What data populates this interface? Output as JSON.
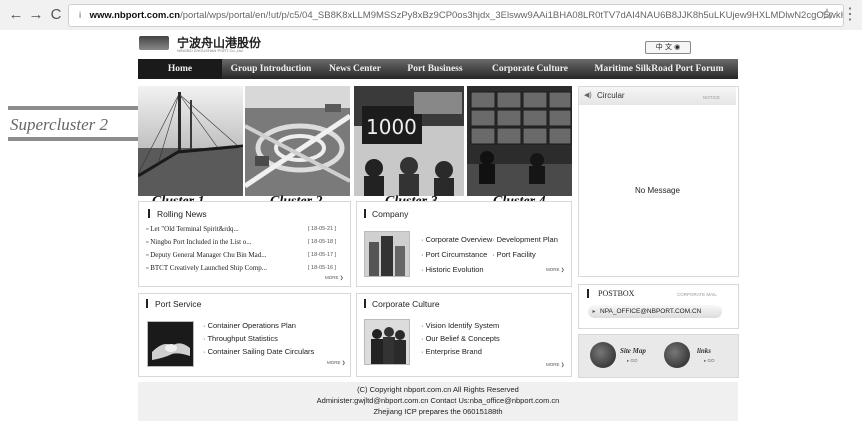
{
  "browser": {
    "back": "←",
    "forward": "→",
    "reload": "C",
    "info_icon": "i",
    "url_host": "www.nbport.com.cn",
    "url_path": "/portal/wps/portal/en/!ut/p/c5/04_SB8K8xLLM9MSSzPy8xBz9CP0os3hjdx_3Elsww9AAi1BHA08LR0tTV7dAI4NAU6B8JJK8h5uLKUjew9HXLMDlwN2cgO5wkH349YPkDXAAR...",
    "star_icon": "☆",
    "menu_icon": "⋮"
  },
  "header": {
    "logo_cn": "宁波舟山港股份",
    "logo_en": "NINGBO ZHOUSHAN PORT Co.,Ltd.",
    "language_select": "中 文 ◉"
  },
  "nav": {
    "items": [
      "Home",
      "Group Introduction",
      "News Center",
      "Port Business",
      "Corporate Culture",
      "Maritime SilkRoad Port Forum"
    ]
  },
  "annotations": {
    "supercluster": "Supercluster 2",
    "clusters": [
      "Cluster 1",
      "Cluster 2",
      "Cluster 3",
      "Cluster 4"
    ]
  },
  "rolling_news": {
    "title": "Rolling News",
    "items": [
      {
        "text": "Let \"Old Terminal Spirit&rdq...",
        "date": "[ 18-05-21 ]"
      },
      {
        "text": "Ningbo Port Included in the List o...",
        "date": "[ 18-05-18 ]"
      },
      {
        "text": "Deputy General Manager Chu Bin Mad...",
        "date": "[ 18-05-17 ]"
      },
      {
        "text": "BTCT Creatively Launched Ship Comp...",
        "date": "[ 18-05-16 ]"
      }
    ],
    "more": "MORE ❯"
  },
  "company": {
    "title": "Company",
    "links": [
      "Corporate Overview",
      "Development Plan",
      "Port Circumstance",
      "Port Facility",
      "Historic Evolution"
    ],
    "more": "MORE ❯"
  },
  "port_service": {
    "title": "Port Service",
    "links": [
      "Container Operations Plan",
      "Throughput Statistics",
      "Container Sailing Date Circulars"
    ],
    "more": "MORE ❯"
  },
  "corporate_culture": {
    "title": "Corporate Culture",
    "links": [
      "Vision Identify System",
      "Our Belief & Concepts",
      "Enterprise Brand"
    ],
    "more": "MORE ❯"
  },
  "circular": {
    "title": "Circular",
    "subtitle": "NOTICE",
    "empty": "No Message"
  },
  "postbox": {
    "title": "POSTBOX",
    "subtitle": "CORPORATE MAIL",
    "email": "NPA_OFFICE@NBPORT.COM.CN"
  },
  "tools": {
    "sitemap": "Site Map",
    "links": "links",
    "go": "▸ GO"
  },
  "footer": {
    "lines": [
      "(C) Copyright nbport.com.cn All Rights Reserved",
      "Administer:gwjltd@nbport.com.cn Contact Us:nba_office@nbport.com.cn",
      "Zhejiang ICP prepares the 06015188th"
    ]
  }
}
